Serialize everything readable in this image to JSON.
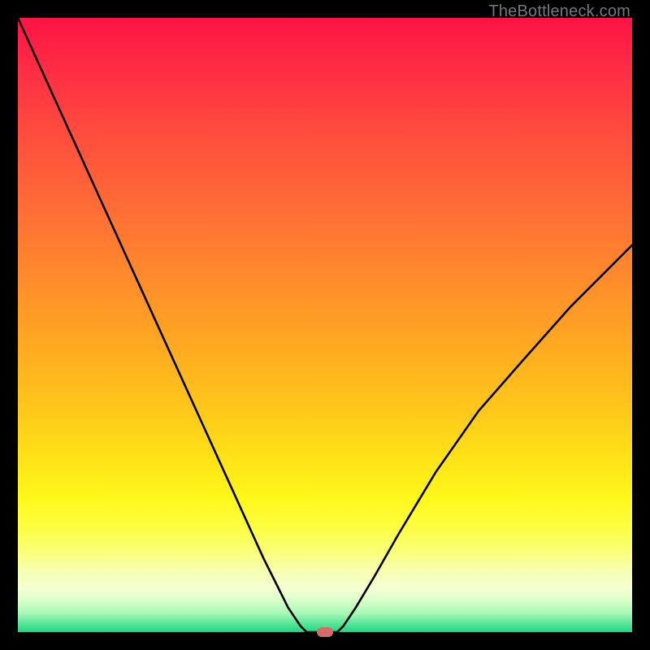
{
  "watermark": "TheBottleneck.com",
  "chart_data": {
    "type": "line",
    "title": "",
    "xlabel": "",
    "ylabel": "",
    "xlim": [
      0,
      100
    ],
    "ylim": [
      0,
      100
    ],
    "series": [
      {
        "name": "bottleneck-curve",
        "x": [
          0,
          5,
          10,
          15,
          20,
          25,
          30,
          35,
          40,
          42,
          44,
          46,
          47,
          48,
          52,
          53,
          55,
          58,
          62,
          68,
          75,
          82,
          90,
          100
        ],
        "y": [
          100,
          89,
          78,
          67,
          56,
          45,
          34,
          23,
          12,
          8,
          4,
          1,
          0,
          0,
          0,
          1,
          4,
          9,
          16,
          26,
          36,
          44,
          53,
          63
        ]
      }
    ],
    "marker": {
      "x": 50,
      "y": 0
    },
    "gradient_stops": [
      {
        "pos": 0,
        "color": "#ff1345"
      },
      {
        "pos": 50,
        "color": "#ffc81a"
      },
      {
        "pos": 80,
        "color": "#fff71a"
      },
      {
        "pos": 100,
        "color": "#1ed87f"
      }
    ]
  }
}
